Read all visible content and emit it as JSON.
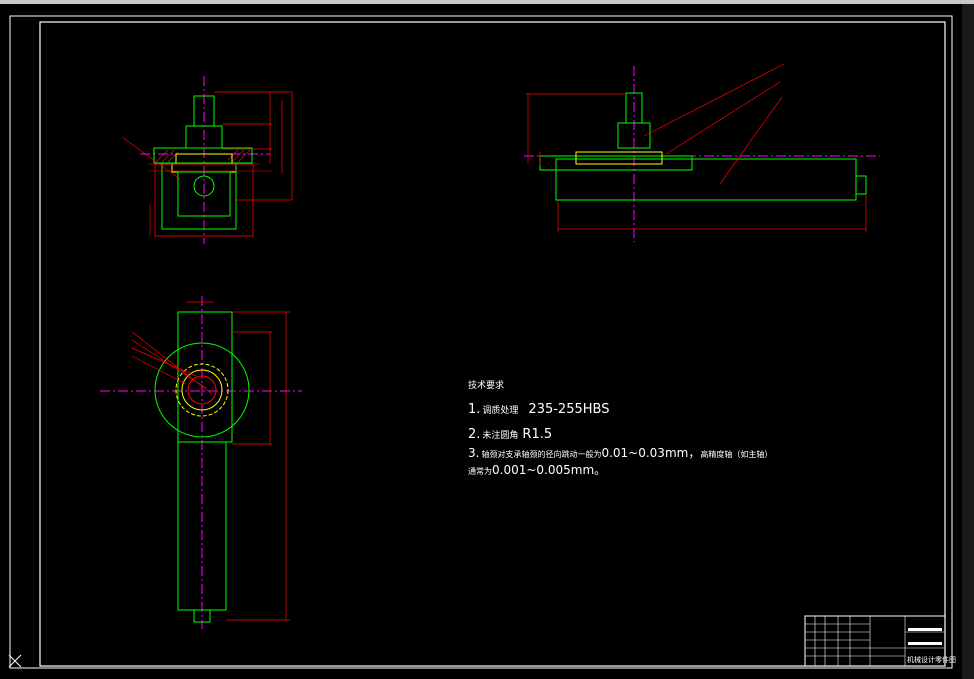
{
  "colors": {
    "background": "#000000",
    "frame": "#ffffff",
    "outline": "#00ff00",
    "dimension": "#ff0000",
    "centerline": "#ff00ff",
    "hidden": "#ffff00",
    "text": "#ffffff"
  },
  "technical_requirements": {
    "title": "技术要求",
    "lines": [
      {
        "prefix": "1.",
        "label": "调质处理",
        "value": "235-255HBS"
      },
      {
        "prefix": "2.",
        "label": "未注圆角",
        "value": "R1.5"
      },
      {
        "prefix": "3.",
        "label": "轴颈对支承轴颈的径向跳动一般为",
        "value": "0.01~0.03mm，",
        "suffix": "高精度轴（如主轴）"
      },
      {
        "prefix": "",
        "label": "通常为",
        "value": "0.001~0.005mm。"
      }
    ]
  },
  "title_block": {
    "drawing_name": "机械设计零件图"
  },
  "icons": {
    "ucs": "ucs-icon",
    "scrollbar": "vertical-scrollbar"
  }
}
